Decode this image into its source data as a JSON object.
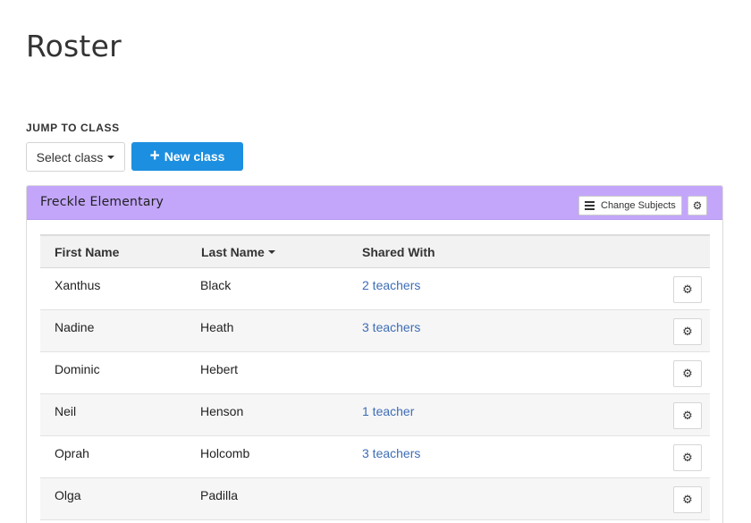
{
  "page": {
    "title": "Roster"
  },
  "jump": {
    "label": "JUMP TO CLASS",
    "select_label": "Select class",
    "new_class_label": "New class"
  },
  "panel": {
    "school_name": "Freckle Elementary",
    "change_subjects_label": "Change Subjects"
  },
  "table": {
    "headers": {
      "first": "First Name",
      "last": "Last Name",
      "shared": "Shared With"
    },
    "rows": [
      {
        "first": "Xanthus",
        "last": "Black",
        "shared": "2 teachers"
      },
      {
        "first": "Nadine",
        "last": "Heath",
        "shared": "3 teachers"
      },
      {
        "first": "Dominic",
        "last": "Hebert",
        "shared": ""
      },
      {
        "first": "Neil",
        "last": "Henson",
        "shared": "1 teacher"
      },
      {
        "first": "Oprah",
        "last": "Holcomb",
        "shared": "3 teachers"
      },
      {
        "first": "Olga",
        "last": "Padilla",
        "shared": ""
      }
    ]
  },
  "icons": {
    "plus": "plus-icon",
    "caret": "caret-down-icon",
    "list": "list-icon",
    "gear": "gear-icon"
  },
  "colors": {
    "primary_button": "#1d8fe0",
    "panel_header": "#c3a6fa",
    "link": "#3e6db5"
  }
}
